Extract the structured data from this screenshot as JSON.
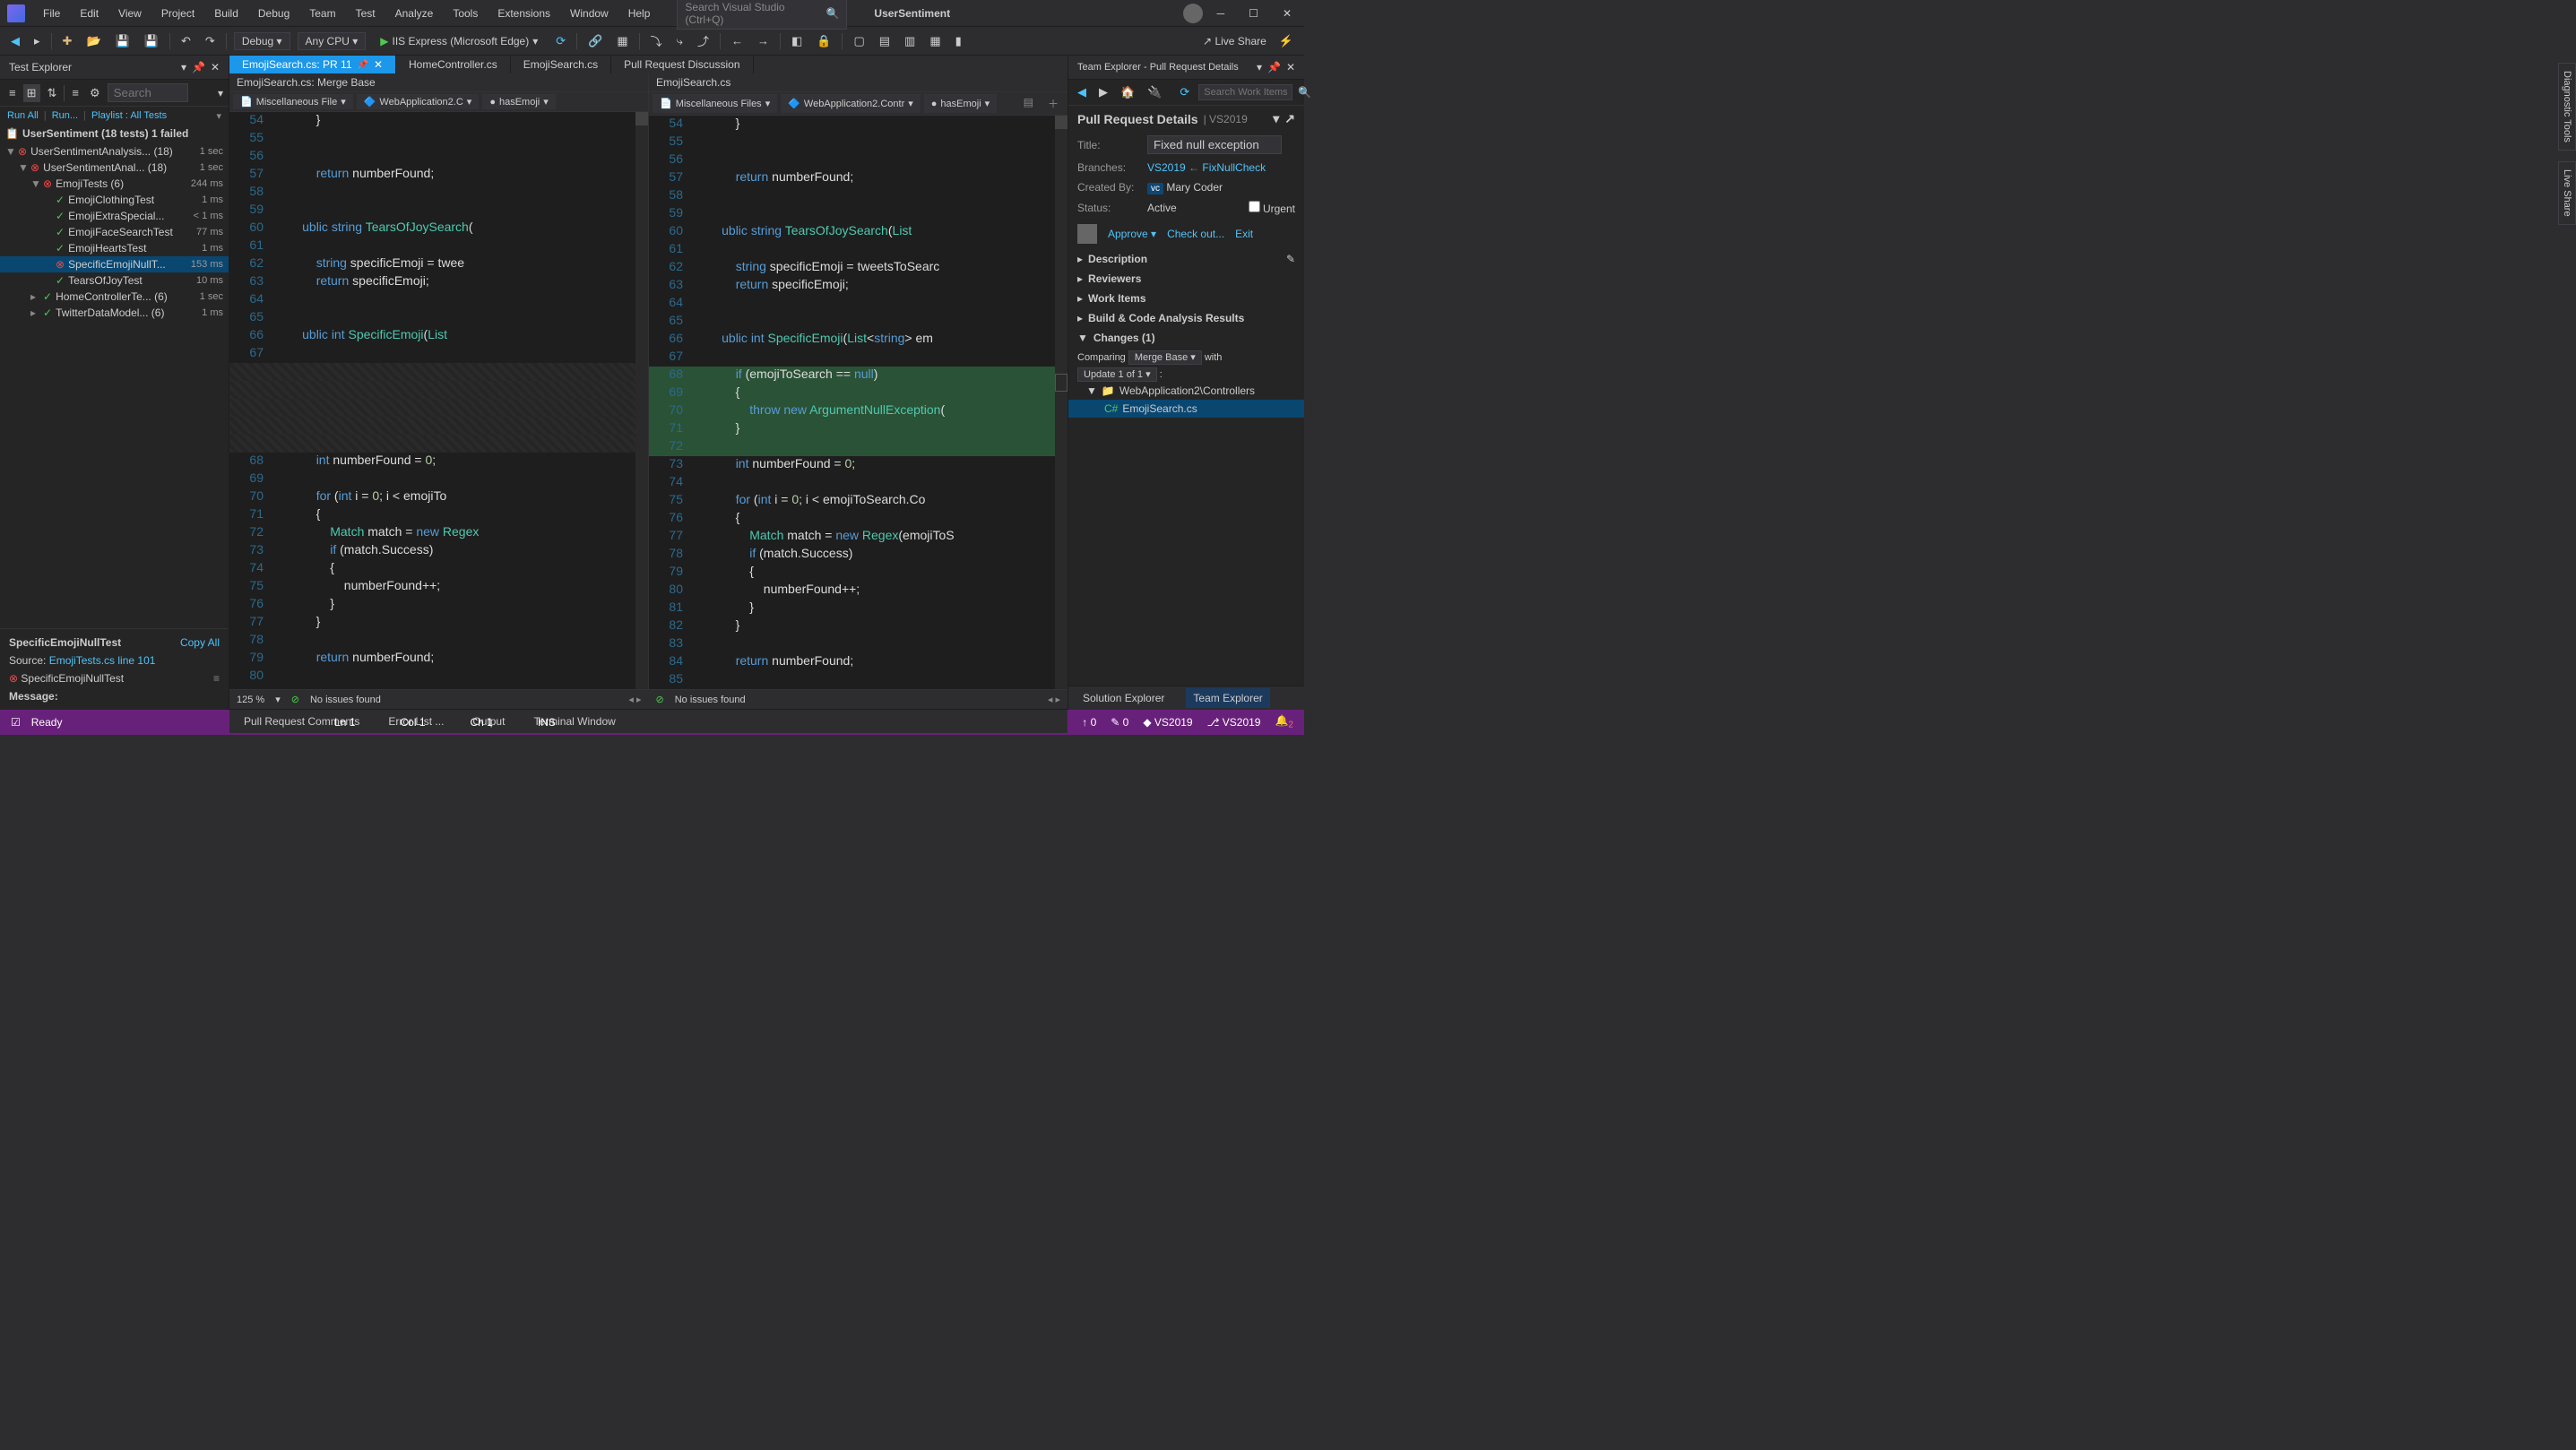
{
  "titlebar": {
    "menu": [
      "File",
      "Edit",
      "View",
      "Project",
      "Build",
      "Debug",
      "Team",
      "Test",
      "Analyze",
      "Tools",
      "Extensions",
      "Window",
      "Help"
    ],
    "search_placeholder": "Search Visual Studio (Ctrl+Q)",
    "solution": "UserSentiment"
  },
  "toolbar": {
    "config": "Debug",
    "platform": "Any CPU",
    "run_label": "IIS Express (Microsoft Edge)",
    "live_share": "Live Share"
  },
  "test_explorer": {
    "title": "Test Explorer",
    "search_placeholder": "Search",
    "links": {
      "run_all": "Run All",
      "run": "Run...",
      "playlist": "Playlist : All Tests"
    },
    "summary": "UserSentiment (18 tests) 1 failed",
    "tree": [
      {
        "depth": 0,
        "caret": "▼",
        "status": "fail",
        "name": "UserSentimentAnalysis... (18)",
        "dur": "1 sec"
      },
      {
        "depth": 1,
        "caret": "▼",
        "status": "fail",
        "name": "UserSentimentAnal... (18)",
        "dur": "1 sec"
      },
      {
        "depth": 2,
        "caret": "▼",
        "status": "fail",
        "name": "EmojiTests (6)",
        "dur": "244 ms"
      },
      {
        "depth": 3,
        "caret": "",
        "status": "pass",
        "name": "EmojiClothingTest",
        "dur": "1 ms"
      },
      {
        "depth": 3,
        "caret": "",
        "status": "pass",
        "name": "EmojiExtraSpecial...",
        "dur": "< 1 ms"
      },
      {
        "depth": 3,
        "caret": "",
        "status": "pass",
        "name": "EmojiFaceSearchTest",
        "dur": "77 ms"
      },
      {
        "depth": 3,
        "caret": "",
        "status": "pass",
        "name": "EmojiHeartsTest",
        "dur": "1 ms"
      },
      {
        "depth": 3,
        "caret": "",
        "status": "fail",
        "name": "SpecificEmojiNullT...",
        "dur": "153 ms",
        "selected": true
      },
      {
        "depth": 3,
        "caret": "",
        "status": "pass",
        "name": "TearsOfJoyTest",
        "dur": "10 ms"
      },
      {
        "depth": 2,
        "caret": "▸",
        "status": "pass",
        "name": "HomeControllerTe... (6)",
        "dur": "1 sec"
      },
      {
        "depth": 2,
        "caret": "▸",
        "status": "pass",
        "name": "TwitterDataModel... (6)",
        "dur": "1 ms"
      }
    ],
    "detail": {
      "name": "SpecificEmojiNullTest",
      "copy": "Copy All",
      "source_label": "Source:",
      "source_link": "EmojiTests.cs line 101",
      "fail_name": "SpecificEmojiNullTest",
      "message_label": "Message:"
    }
  },
  "tabs": [
    {
      "label": "EmojiSearch.cs: PR 11",
      "active": true,
      "pinned": true
    },
    {
      "label": "HomeController.cs",
      "active": false
    },
    {
      "label": "EmojiSearch.cs",
      "active": false
    },
    {
      "label": "Pull Request Discussion",
      "active": false
    }
  ],
  "diff": {
    "left_header": "EmojiSearch.cs: Merge Base",
    "right_header": "EmojiSearch.cs",
    "bc_left": [
      "Miscellaneous File",
      "WebApplication2.C",
      "hasEmoji"
    ],
    "bc_right": [
      "Miscellaneous Files",
      "WebApplication2.Contr",
      "hasEmoji"
    ],
    "left_lines": [
      {
        "n": 54,
        "t": "            }"
      },
      {
        "n": 55,
        "t": ""
      },
      {
        "n": 56,
        "t": ""
      },
      {
        "n": 57,
        "t": "            return numberFound;",
        "kw": [
          "return"
        ]
      },
      {
        "n": 58,
        "t": ""
      },
      {
        "n": 59,
        "t": ""
      },
      {
        "n": 60,
        "t": "        ublic string TearsOfJoySearch("
      },
      {
        "n": 61,
        "t": ""
      },
      {
        "n": 62,
        "t": "            string specificEmoji = twee"
      },
      {
        "n": 63,
        "t": "            return specificEmoji;",
        "kw": [
          "return"
        ]
      },
      {
        "n": 64,
        "t": ""
      },
      {
        "n": 65,
        "t": ""
      },
      {
        "n": 66,
        "t": "        ublic int SpecificEmoji(List<s"
      },
      {
        "n": 67,
        "t": ""
      },
      {
        "n": "",
        "t": "",
        "diff": true
      },
      {
        "n": "",
        "t": "",
        "diff": true
      },
      {
        "n": "",
        "t": "",
        "diff": true
      },
      {
        "n": "",
        "t": "",
        "diff": true
      },
      {
        "n": "",
        "t": "",
        "diff": true
      },
      {
        "n": 68,
        "t": "            int numberFound = 0;"
      },
      {
        "n": 69,
        "t": ""
      },
      {
        "n": 70,
        "t": "            for (int i = 0; i < emojiTo"
      },
      {
        "n": 71,
        "t": "            {"
      },
      {
        "n": 72,
        "t": "                Match match = new Regex"
      },
      {
        "n": 73,
        "t": "                if (match.Success)"
      },
      {
        "n": 74,
        "t": "                {"
      },
      {
        "n": 75,
        "t": "                    numberFound++;"
      },
      {
        "n": 76,
        "t": "                }"
      },
      {
        "n": 77,
        "t": "            }"
      },
      {
        "n": 78,
        "t": ""
      },
      {
        "n": 79,
        "t": "            return numberFound;",
        "kw": [
          "return"
        ]
      },
      {
        "n": 80,
        "t": ""
      }
    ],
    "right_lines": [
      {
        "n": 54,
        "t": "            }"
      },
      {
        "n": 55,
        "t": ""
      },
      {
        "n": 56,
        "t": ""
      },
      {
        "n": 57,
        "t": "            return numberFound;",
        "kw": [
          "return"
        ]
      },
      {
        "n": 58,
        "t": ""
      },
      {
        "n": 59,
        "t": ""
      },
      {
        "n": 60,
        "t": "        ublic string TearsOfJoySearch(List<stri"
      },
      {
        "n": 61,
        "t": ""
      },
      {
        "n": 62,
        "t": "            string specificEmoji = tweetsToSearc"
      },
      {
        "n": 63,
        "t": "            return specificEmoji;",
        "kw": [
          "return"
        ]
      },
      {
        "n": 64,
        "t": ""
      },
      {
        "n": 65,
        "t": ""
      },
      {
        "n": 66,
        "t": "        ublic int SpecificEmoji(List<string> em"
      },
      {
        "n": 67,
        "t": ""
      },
      {
        "n": 68,
        "t": "            if (emojiToSearch == null)",
        "added": true
      },
      {
        "n": 69,
        "t": "            {",
        "added": true
      },
      {
        "n": 70,
        "t": "                throw new ArgumentNullException(",
        "added": true
      },
      {
        "n": 71,
        "t": "            }",
        "added": true
      },
      {
        "n": 72,
        "t": "",
        "added": true
      },
      {
        "n": 73,
        "t": "            int numberFound = 0;"
      },
      {
        "n": 74,
        "t": ""
      },
      {
        "n": 75,
        "t": "            for (int i = 0; i < emojiToSearch.Co"
      },
      {
        "n": 76,
        "t": "            {"
      },
      {
        "n": 77,
        "t": "                Match match = new Regex(emojiToS"
      },
      {
        "n": 78,
        "t": "                if (match.Success)"
      },
      {
        "n": 79,
        "t": "                {"
      },
      {
        "n": 80,
        "t": "                    numberFound++;"
      },
      {
        "n": 81,
        "t": "                }"
      },
      {
        "n": 82,
        "t": "            }"
      },
      {
        "n": 83,
        "t": ""
      },
      {
        "n": 84,
        "t": "            return numberFound;",
        "kw": [
          "return"
        ]
      },
      {
        "n": 85,
        "t": ""
      }
    ],
    "zoom": "125 %",
    "no_issues": "No issues found"
  },
  "team_explorer": {
    "title": "Team Explorer - Pull Request Details",
    "search_placeholder": "Search Work Items",
    "main_title": "Pull Request Details",
    "context": "VS2019",
    "fields": {
      "title_label": "Title:",
      "title_value": "Fixed null exception",
      "branches_label": "Branches:",
      "branch_target": "VS2019",
      "branch_source": "FixNullCheck",
      "created_label": "Created By:",
      "created_by": "Mary Coder",
      "status_label": "Status:",
      "status_value": "Active",
      "urgent_label": "Urgent"
    },
    "actions": {
      "approve": "Approve",
      "checkout": "Check out...",
      "exit": "Exit"
    },
    "sections": [
      "Description",
      "Reviewers",
      "Work Items",
      "Build & Code Analysis Results"
    ],
    "changes_label": "Changes (1)",
    "comparing_label": "Comparing",
    "compare_mode": "Merge Base",
    "with_label": "with",
    "update_label": "Update 1 of 1",
    "folder": "WebApplication2\\Controllers",
    "file": "EmojiSearch.cs"
  },
  "bottom_tabs_left": [
    "Pull Request Comments",
    "Error List ...",
    "Output",
    "Terminal Window"
  ],
  "bottom_tabs_right": [
    "Solution Explorer",
    "Team Explorer"
  ],
  "statusbar": {
    "ready": "Ready",
    "ln": "Ln 1",
    "col": "Col 1",
    "ch": "Ch 1",
    "ins": "INS",
    "up": "0",
    "down": "0",
    "repo": "VS2019",
    "branch": "VS2019",
    "notif": "2"
  },
  "side_tabs": [
    "Diagnostic Tools",
    "Live Share"
  ]
}
